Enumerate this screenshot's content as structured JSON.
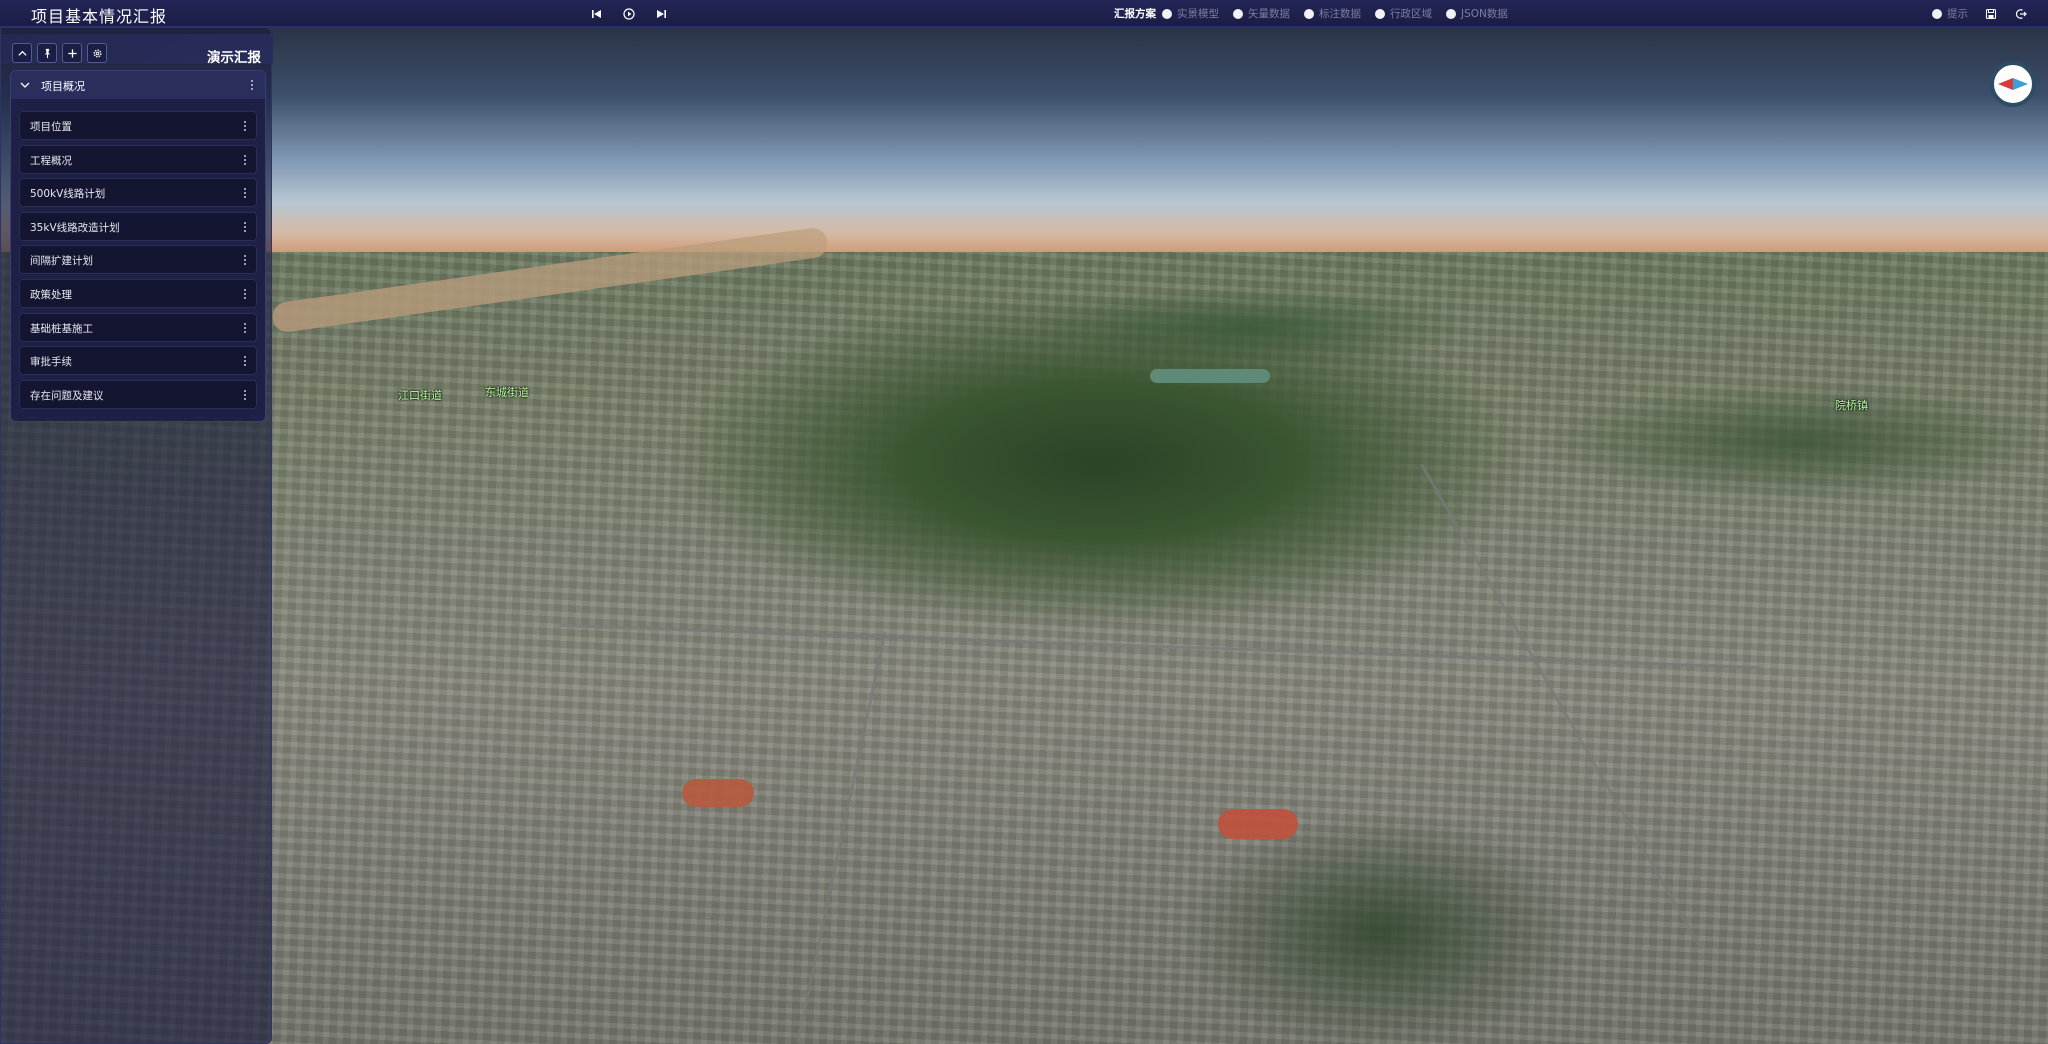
{
  "app": {
    "title": "项目基本情况汇报"
  },
  "playback": {
    "prev_icon": "skip-previous-icon",
    "play_icon": "play-circle-icon",
    "next_icon": "skip-next-icon"
  },
  "scheme": {
    "label": "汇报方案",
    "options": [
      {
        "label": "实景模型",
        "selected": false
      },
      {
        "label": "矢量数据",
        "selected": false
      },
      {
        "label": "标注数据",
        "selected": false
      },
      {
        "label": "行政区域",
        "selected": false
      },
      {
        "label": "JSON数据",
        "selected": false
      }
    ]
  },
  "top_right": {
    "toggle_label": "提示",
    "save_icon": "save-icon",
    "logout_icon": "logout-icon"
  },
  "panel": {
    "title": "演示汇报",
    "toolbar_icons": [
      "collapse-up-icon",
      "pin-icon",
      "add-icon",
      "settings-icon"
    ],
    "section": {
      "title": "项目概况",
      "items": [
        {
          "label": "项目位置"
        },
        {
          "label": "工程概况"
        },
        {
          "label": "500kV线路计划"
        },
        {
          "label": "35kV线路改造计划"
        },
        {
          "label": "间隔扩建计划"
        },
        {
          "label": "政策处理"
        },
        {
          "label": "基础桩基施工"
        },
        {
          "label": "审批手续"
        },
        {
          "label": "存在问题及建议"
        }
      ]
    }
  },
  "map": {
    "labels": [
      {
        "text": "江口街道"
      },
      {
        "text": "东城街道"
      },
      {
        "text": "院桥镇"
      }
    ],
    "compass_icon": "compass-icon",
    "colors": {
      "accent": "#2d4d63",
      "label": "#b8ff9e",
      "panel_bg": "#161a3a"
    }
  }
}
